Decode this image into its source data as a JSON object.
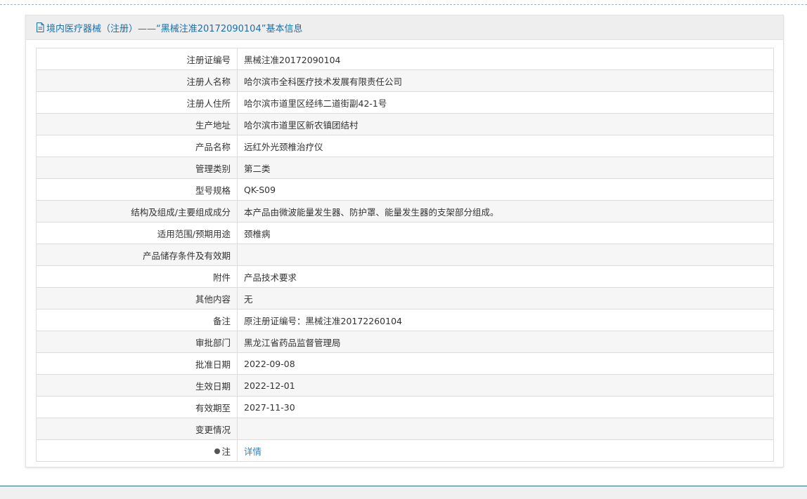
{
  "panel": {
    "title": "境内医疗器械（注册）——“黑械注准20172090104”基本信息",
    "icon": "document-icon",
    "accent_color": "#1a6fad"
  },
  "rows": [
    {
      "label": "注册证编号",
      "value": "黑械注准20172090104"
    },
    {
      "label": "注册人名称",
      "value": "哈尔滨市全科医疗技术发展有限责任公司"
    },
    {
      "label": "注册人住所",
      "value": "哈尔滨市道里区经纬二道街副42-1号"
    },
    {
      "label": "生产地址",
      "value": "哈尔滨市道里区新农镇团结村"
    },
    {
      "label": "产品名称",
      "value": "远红外光颈椎治疗仪"
    },
    {
      "label": "管理类别",
      "value": "第二类"
    },
    {
      "label": "型号规格",
      "value": "QK-S09"
    },
    {
      "label": "结构及组成/主要组成成分",
      "value": "本产品由微波能量发生器、防护罩、能量发生器的支架部分组成。"
    },
    {
      "label": "适用范围/预期用途",
      "value": "颈椎病"
    },
    {
      "label": "产品储存条件及有效期",
      "value": ""
    },
    {
      "label": "附件",
      "value": "产品技术要求"
    },
    {
      "label": "其他内容",
      "value": "无"
    },
    {
      "label": "备注",
      "value": "原注册证编号：黑械注准20172260104"
    },
    {
      "label": "审批部门",
      "value": "黑龙江省药品监督管理局"
    },
    {
      "label": "批准日期",
      "value": "2022-09-08"
    },
    {
      "label": "生效日期",
      "value": "2022-12-01"
    },
    {
      "label": "有效期至",
      "value": "2027-11-30"
    },
    {
      "label": "变更情况",
      "value": ""
    }
  ],
  "note": {
    "label": "注",
    "link_text": "详情",
    "icon": "bullet-icon"
  }
}
